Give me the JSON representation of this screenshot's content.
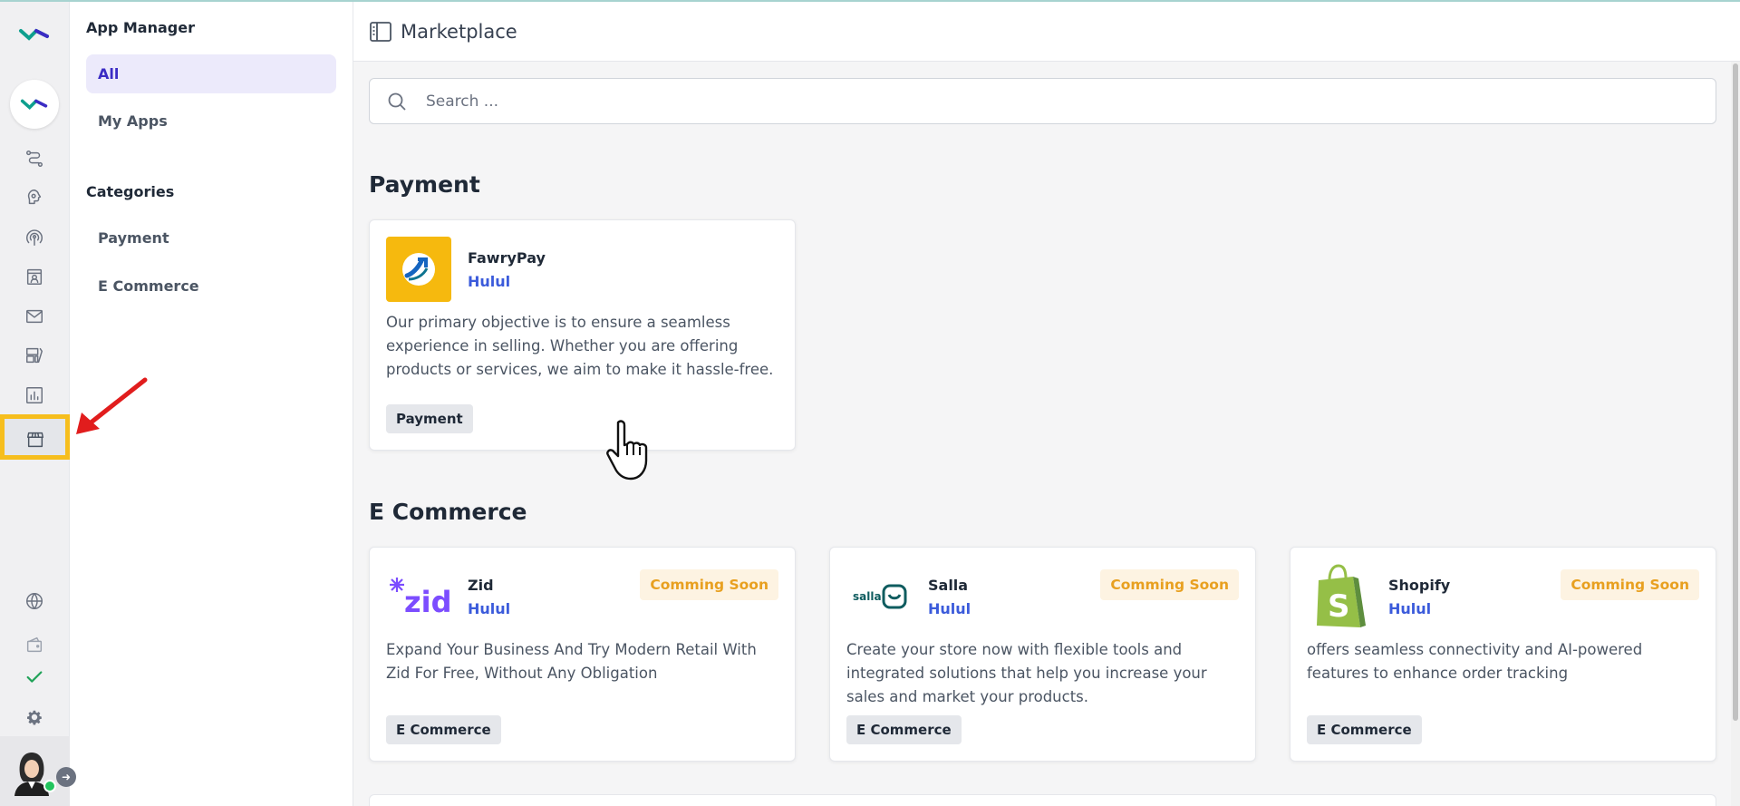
{
  "app": {
    "section": "App Manager",
    "page_title": "Marketplace"
  },
  "subnav": {
    "items": [
      {
        "label": "All",
        "active": true
      },
      {
        "label": "My Apps",
        "active": false
      }
    ],
    "categories_heading": "Categories",
    "categories": [
      {
        "label": "Payment"
      },
      {
        "label": "E Commerce"
      }
    ]
  },
  "rail": {
    "icons": [
      "brand-logo-icon",
      "workflow-icon",
      "brain-icon",
      "broadcast-icon",
      "contacts-icon",
      "mail-icon",
      "templates-icon",
      "reports-icon",
      "marketplace-icon",
      "globe-icon",
      "wallet-icon",
      "check-icon",
      "settings-icon"
    ],
    "active": "marketplace-icon"
  },
  "search": {
    "placeholder": "Search ..."
  },
  "sections": {
    "payment": {
      "title": "Payment",
      "apps": [
        {
          "name": "FawryPay",
          "vendor": "Hulul",
          "description": "Our primary objective is to ensure a seamless experience in selling. Whether you are offering products or services, we aim to make it hassle-free.",
          "tag": "Payment"
        }
      ]
    },
    "ecommerce": {
      "title": "E Commerce",
      "apps": [
        {
          "name": "Zid",
          "vendor": "Hulul",
          "badge": "Comming Soon",
          "description": "Expand Your Business And Try Modern Retail With Zid For Free, Without Any Obligation",
          "tag": "E Commerce",
          "logo_text": "zid"
        },
        {
          "name": "Salla",
          "vendor": "Hulul",
          "badge": "Comming Soon",
          "description": "Create your store now with flexible tools and integrated solutions that help you increase your sales and market your products.",
          "tag": "E Commerce",
          "logo_text": "salla"
        },
        {
          "name": "Shopify",
          "vendor": "Hulul",
          "badge": "Comming Soon",
          "description": "offers seamless connectivity and AI-powered features to enhance order tracking",
          "tag": "E Commerce"
        }
      ]
    }
  },
  "colors": {
    "accent": "#3b2cc4",
    "vendor": "#3b5bdb",
    "soon_badge": "#e8a020",
    "highlight": "#f6be1d",
    "arrow": "#e11d1d",
    "fawry_bg": "#f6b90e",
    "zid": "#7c4dff",
    "salla": "#0f5c5f",
    "shopify": "#95bf47"
  }
}
